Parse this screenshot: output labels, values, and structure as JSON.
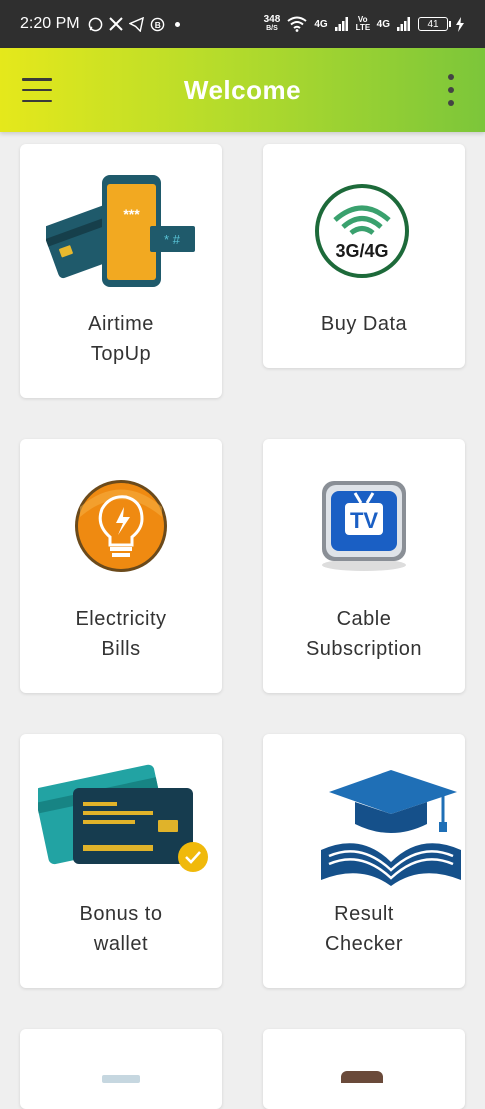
{
  "status_bar": {
    "time": "2:20 PM",
    "net_speed_value": "348",
    "net_speed_unit": "B/S",
    "network_1": "4G",
    "volte": "Vo LTE",
    "network_2": "4G",
    "battery": "41"
  },
  "app_bar": {
    "title": "Welcome"
  },
  "services": [
    {
      "line1": "Airtime",
      "line2": "TopUp"
    },
    {
      "line1": "Buy Data",
      "line2": ""
    },
    {
      "line1": "Electricity",
      "line2": "Bills"
    },
    {
      "line1": "Cable",
      "line2": "Subscription"
    },
    {
      "line1": "Bonus to",
      "line2": "wallet"
    },
    {
      "line1": "Result",
      "line2": "Checker"
    }
  ],
  "icons": {
    "data_badge": "3G/4G",
    "tv_badge": "TV",
    "airtime_stars": "***",
    "airtime_hash": "* #"
  }
}
